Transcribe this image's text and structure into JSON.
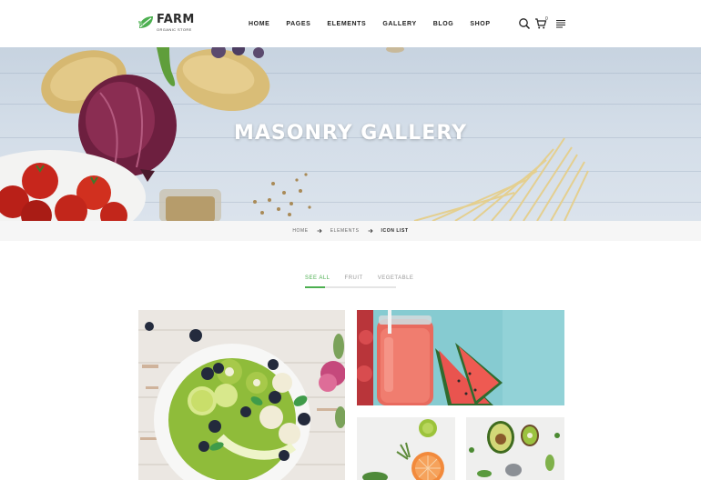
{
  "brand": {
    "name": "FARM",
    "tagline": "ORGANIC STORE",
    "accent_color": "#4caf50",
    "icon": "leaf-icon"
  },
  "nav": {
    "items": [
      {
        "label": "HOME"
      },
      {
        "label": "PAGES"
      },
      {
        "label": "ELEMENTS"
      },
      {
        "label": "GALLERY"
      },
      {
        "label": "BLOG"
      },
      {
        "label": "SHOP"
      }
    ]
  },
  "header_actions": {
    "search_icon": "search-icon",
    "cart_icon": "cart-icon",
    "cart_count": "0",
    "menu_icon": "menu-icon"
  },
  "hero": {
    "title": "MASONRY GALLERY"
  },
  "breadcrumb": {
    "items": [
      {
        "label": "HOME"
      },
      {
        "label": "ELEMENTS"
      },
      {
        "label": "ICON LIST"
      }
    ],
    "separator_icon": "arrow-right-icon"
  },
  "filter": {
    "tabs": [
      {
        "label": "SEE ALL",
        "active": true
      },
      {
        "label": "FRUIT",
        "active": false
      },
      {
        "label": "VEGETABLE",
        "active": false
      }
    ]
  },
  "gallery": {
    "items": [
      {
        "subject": "smoothie bowl with kiwi and blueberries"
      },
      {
        "subject": "watermelon juice and watermelon slices"
      },
      {
        "subject": "grapefruit and lime"
      },
      {
        "subject": "avocado and kiwi halves"
      }
    ]
  }
}
